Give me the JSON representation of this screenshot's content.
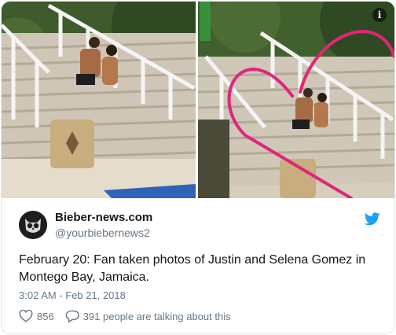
{
  "tweet": {
    "author_name": "Bieber-news.com",
    "author_handle": "@yourbiebernews2",
    "text": "February 20: Fan taken photos of Justin and Selena Gomez in Montego Bay, Jamaica.",
    "timestamp": "3:02 AM - Feb 21, 2018",
    "likes": "856",
    "talking": "391 people are talking about this"
  },
  "icons": {
    "info": "i",
    "info_icon": "info-icon",
    "bird_icon": "twitter-bird-icon",
    "heart_icon": "heart-icon",
    "comment_icon": "comment-icon",
    "avatar": "owl-avatar"
  },
  "colors": {
    "twitter_blue": "#1da1f2",
    "secondary_text": "#657786",
    "primary_text": "#14171a",
    "heart_drawing": "#e0257a"
  }
}
